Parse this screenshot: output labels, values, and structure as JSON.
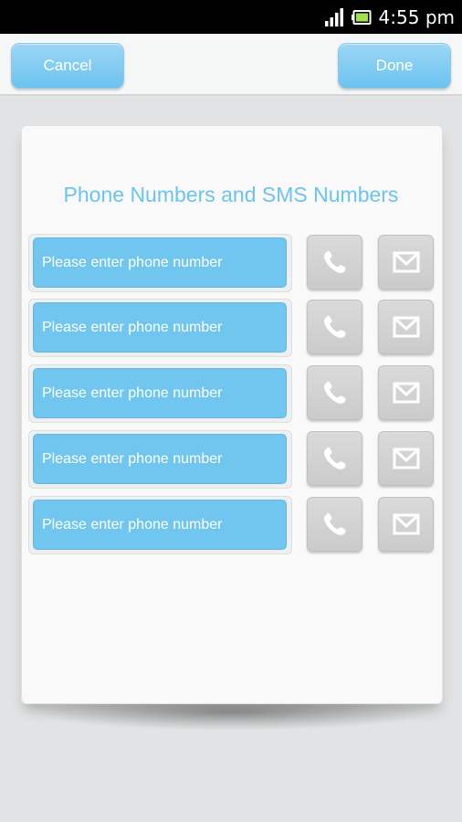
{
  "status_bar": {
    "time": "4:55 pm",
    "icons": [
      "signal-icon",
      "battery-icon"
    ]
  },
  "toolbar": {
    "cancel_label": "Cancel",
    "done_label": "Done"
  },
  "card": {
    "title": "Phone Numbers and SMS Numbers",
    "rows": [
      {
        "placeholder": "Please enter phone number"
      },
      {
        "placeholder": "Please enter phone number"
      },
      {
        "placeholder": "Please enter phone number"
      },
      {
        "placeholder": "Please enter phone number"
      },
      {
        "placeholder": "Please enter phone number"
      }
    ],
    "row_icons": [
      "phone-icon",
      "mail-icon"
    ]
  },
  "colors": {
    "accent": "#71c6ef",
    "title": "#6cc4ee",
    "icon_button": "#d3d3d3",
    "status_bar": "#000000"
  }
}
